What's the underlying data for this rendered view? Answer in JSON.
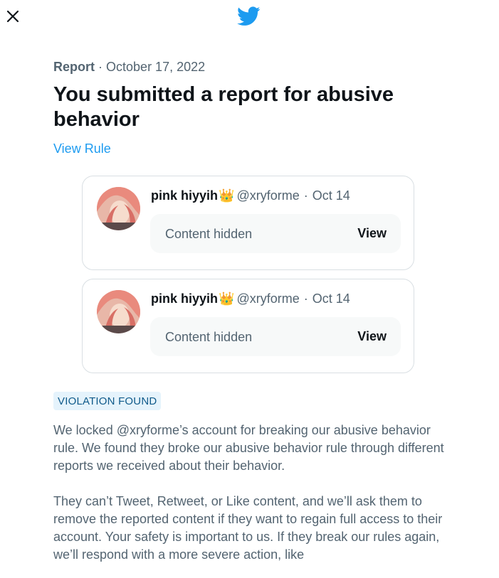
{
  "header": {
    "close_icon": "close-icon",
    "logo_icon": "twitter-bird-icon"
  },
  "report": {
    "label": "Report",
    "separator": "·",
    "date": "October 17, 2022",
    "title": "You submitted a report for abusive behavior",
    "view_rule_label": "View Rule"
  },
  "tweets": [
    {
      "name": "pink hiyyih",
      "crown_icon": "👑",
      "handle": "@xryforme",
      "separator": "·",
      "date": "Oct 14",
      "hidden_text": "Content hidden",
      "view_label": "View"
    },
    {
      "name": "pink hiyyih",
      "crown_icon": "👑",
      "handle": "@xryforme",
      "separator": "·",
      "date": "Oct 14",
      "hidden_text": "Content hidden",
      "view_label": "View"
    }
  ],
  "violation": {
    "badge": "VIOLATION FOUND",
    "paragraph1": "We locked @xryforme’s account for breaking our abusive behavior rule. We found they broke our abusive behavior rule through different reports we received about their behavior.",
    "paragraph2": "They can’t Tweet, Retweet, or Like content, and we’ll ask them to remove the reported content if they want to regain full access to their account. Your safety is important to us. If they break our rules again, we’ll respond with a more severe action, like"
  },
  "colors": {
    "accent": "#1d9bf0",
    "text_primary": "#0f1419",
    "text_secondary": "#536471",
    "badge_bg": "#e5f3fc",
    "card_border": "#d9dfe3"
  }
}
